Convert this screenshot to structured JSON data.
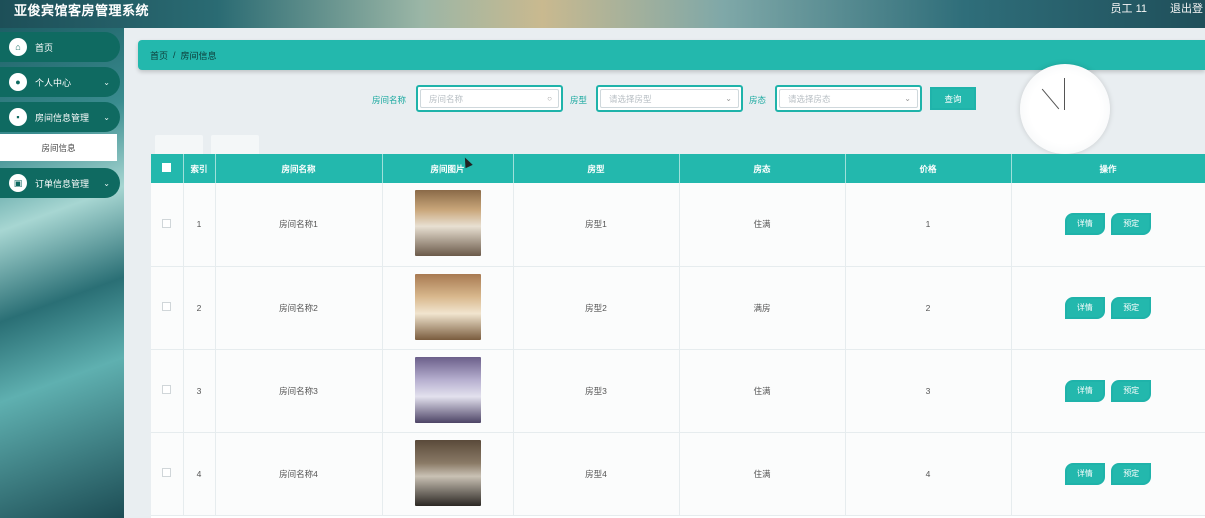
{
  "app": {
    "title": "亚俊宾馆客房管理系统",
    "user": "员工 11",
    "logout": "退出登"
  },
  "sidebar": {
    "items": [
      {
        "label": "首页",
        "icon": "home-icon"
      },
      {
        "label": "个人中心",
        "icon": "user-icon"
      },
      {
        "label": "房间信息管理",
        "icon": "room-icon"
      },
      {
        "label": "订单信息管理",
        "icon": "order-icon"
      }
    ],
    "submenu": {
      "label": "房间信息"
    }
  },
  "breadcrumb": {
    "home": "首页",
    "sep": "/",
    "current": "房间信息"
  },
  "search": {
    "name_label": "房间名称",
    "name_placeholder": "房间名称",
    "type_label": "房型",
    "type_placeholder": "请选择房型",
    "status_label": "房态",
    "status_placeholder": "请选择房态",
    "button": "查询"
  },
  "table": {
    "headers": [
      "索引",
      "房间名称",
      "房间图片",
      "房型",
      "房态",
      "价格",
      "操作"
    ],
    "rows": [
      {
        "index": "1",
        "name": "房间名称1",
        "type": "房型1",
        "status": "住满",
        "price": "1"
      },
      {
        "index": "2",
        "name": "房间名称2",
        "type": "房型2",
        "status": "满房",
        "price": "2"
      },
      {
        "index": "3",
        "name": "房间名称3",
        "type": "房型3",
        "status": "住满",
        "price": "3"
      },
      {
        "index": "4",
        "name": "房间名称4",
        "type": "房型4",
        "status": "住满",
        "price": "4"
      }
    ],
    "actions": {
      "detail": "详情",
      "book": "预定"
    }
  },
  "colors": {
    "accent": "#23b8ad",
    "sidebar_item": "#0f6a61"
  }
}
